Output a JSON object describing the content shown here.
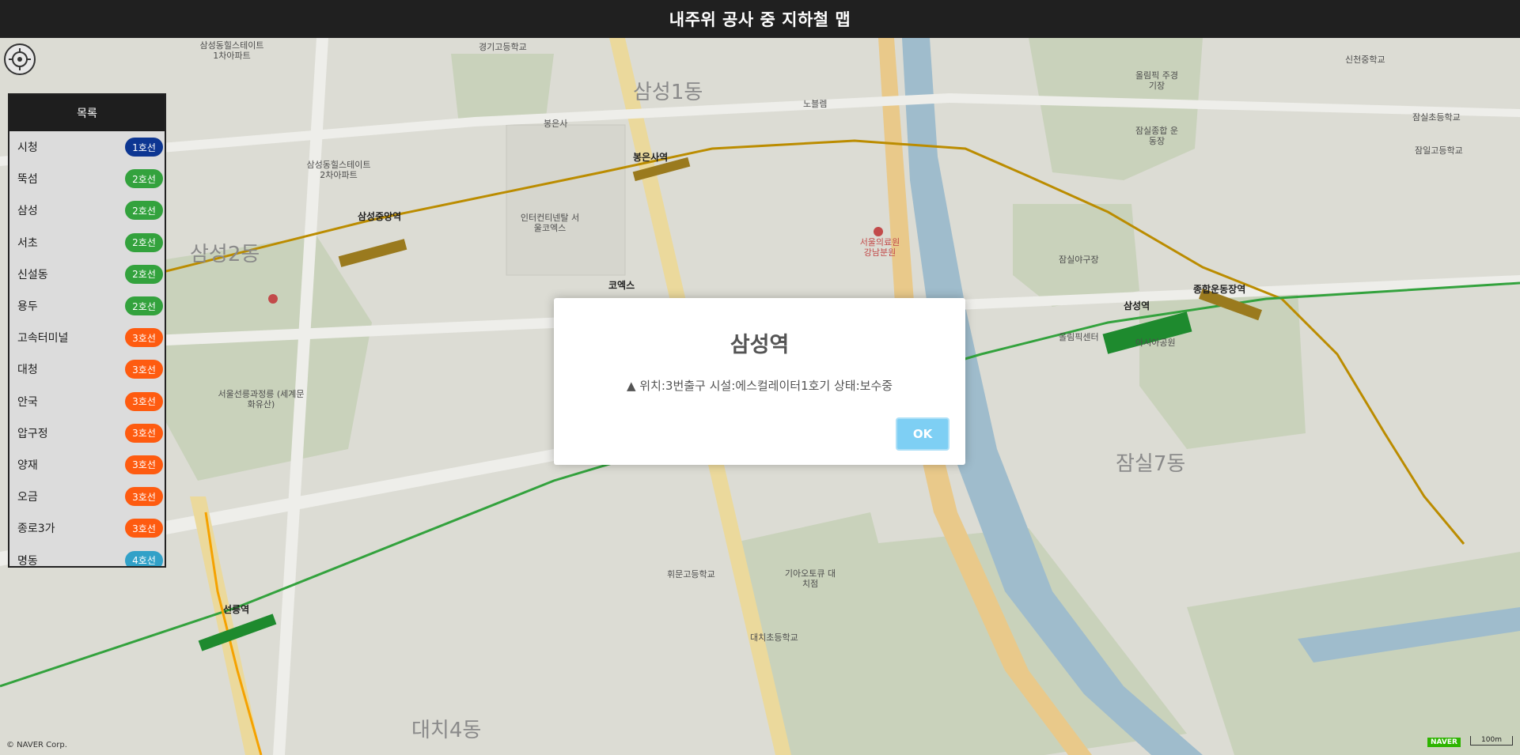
{
  "header": {
    "title": "내주위 공사 중 지하철 맵"
  },
  "panel": {
    "title": "목록",
    "items": [
      {
        "name": "시청",
        "line": "1호선",
        "color": "#0d3692"
      },
      {
        "name": "뚝섬",
        "line": "2호선",
        "color": "#33a23d"
      },
      {
        "name": "삼성",
        "line": "2호선",
        "color": "#33a23d"
      },
      {
        "name": "서초",
        "line": "2호선",
        "color": "#33a23d"
      },
      {
        "name": "신설동",
        "line": "2호선",
        "color": "#33a23d"
      },
      {
        "name": "용두",
        "line": "2호선",
        "color": "#33a23d"
      },
      {
        "name": "고속터미널",
        "line": "3호선",
        "color": "#fe5b10"
      },
      {
        "name": "대청",
        "line": "3호선",
        "color": "#fe5b10"
      },
      {
        "name": "안국",
        "line": "3호선",
        "color": "#fe5b10"
      },
      {
        "name": "압구정",
        "line": "3호선",
        "color": "#fe5b10"
      },
      {
        "name": "양재",
        "line": "3호선",
        "color": "#fe5b10"
      },
      {
        "name": "오금",
        "line": "3호선",
        "color": "#fe5b10"
      },
      {
        "name": "종로3가",
        "line": "3호선",
        "color": "#fe5b10"
      },
      {
        "name": "명동",
        "line": "4호선",
        "color": "#32a1c8"
      }
    ]
  },
  "modal": {
    "title": "삼성역",
    "message": "▲ 위치:3번출구 시설:에스컬레이터1호기 상태:보수중",
    "ok_label": "OK"
  },
  "map": {
    "labels": {
      "samseong1": "삼성1동",
      "samseong2": "삼성2동",
      "jamsil7": "잠실7동",
      "daechi4": "대치4동",
      "samsung_station": "삼성역",
      "bongeunsa_station": "봉은사역",
      "samseong_jungang_station": "삼성중앙역",
      "sports_complex_station": "종합운동장역",
      "seolleung_station": "선릉역",
      "coex": "코엑스",
      "olympic_stadium": "올림픽 주경기장",
      "jamsil_sports": "잠실종합 운동장",
      "olympic_center": "올림픽센터",
      "jamsil_baseball": "잠실야구장",
      "seoul_hospital": "서울의료원 강남분원",
      "coex_intercontinental": "인터컨티넨탈 서울코엑스",
      "bongeunsa": "봉은사",
      "seolleung_park": "서울선릉과정릉 (세계문화유산)",
      "jamsil_elem": "잠실초등학교",
      "sincheon_middle": "신천중학교",
      "jamsil_high": "잠일고등학교",
      "gyeonggi_high": "경기고등학교",
      "eonju_plaza": "노블렘",
      "samseong_hillstate1": "삼성동힐스테이트 1차아파트",
      "samseong_hillstate2": "삼성동힐스테이트 2차아파트",
      "daechi_elem": "대치초등학교",
      "hwimun_high": "휘문고등학교",
      "kia_tower": "기아오토큐 대치점",
      "olympic_park": "아시아공원",
      "naver_corp": "© NAVER Corp.",
      "naver": "NAVER",
      "scale": "100m"
    }
  },
  "colors": {
    "line2": "#33a23d",
    "line9": "#bb8c00",
    "line_suin": "#f5a200",
    "river": "#8fb6d0",
    "park": "#cfd9bd"
  },
  "icons": {
    "locate": "crosshair-icon"
  }
}
